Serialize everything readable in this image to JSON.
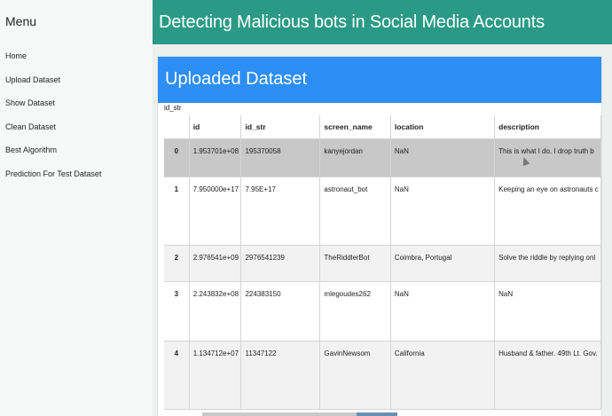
{
  "sidebar": {
    "title": "Menu",
    "items": [
      {
        "label": "Home"
      },
      {
        "label": "Upload Dataset"
      },
      {
        "label": "Show Dataset"
      },
      {
        "label": "Clean Dataset"
      },
      {
        "label": "Best Algorithm"
      },
      {
        "label": "Prediction For Test Dataset"
      }
    ]
  },
  "header": {
    "title": "Detecting Malicious bots in Social Media Accounts",
    "color": "#2a9a86"
  },
  "panel": {
    "title": "Uploaded Dataset",
    "color": "#2d8ef5",
    "index_label": "id_str"
  },
  "table": {
    "columns": [
      "",
      "id",
      "id_str",
      "screen_name",
      "location",
      "description"
    ],
    "rows": [
      {
        "index": "0",
        "id": "1.953701e+08",
        "id_str": "195370058",
        "screen_name": "kanyejordan",
        "location": "NaN",
        "description": "This is what I do. I drop truth b"
      },
      {
        "index": "1",
        "id": "7.950000e+17",
        "id_str": "7.95E+17",
        "screen_name": "astronaut_bot",
        "location": "NaN",
        "description": "Keeping an eye on astronauts c"
      },
      {
        "index": "2",
        "id": "2.976541e+09",
        "id_str": "2976541239",
        "screen_name": "TheRiddlerBot",
        "location": "Coimbra, Portugal",
        "description": "Solve the riddle by replying onl"
      },
      {
        "index": "3",
        "id": "2.243832e+08",
        "id_str": "224383150",
        "screen_name": "mlegoudes262",
        "location": "NaN",
        "description": "NaN"
      },
      {
        "index": "4",
        "id": "1.134712e+07",
        "id_str": "11347122",
        "screen_name": "GavinNewsom",
        "location": "California",
        "description": "Husband & father. 49th Lt. Gov."
      }
    ]
  }
}
